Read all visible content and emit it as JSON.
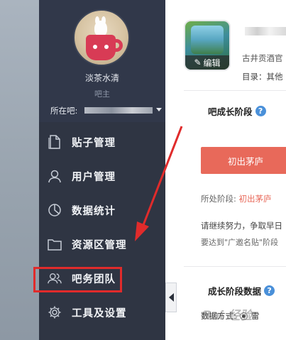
{
  "profile": {
    "name": "淡茶水清",
    "role": "吧主",
    "forum_label": "所在吧:",
    "forum_value": ""
  },
  "menu": {
    "items": [
      {
        "label": "贴子管理",
        "icon": "document-icon"
      },
      {
        "label": "用户管理",
        "icon": "user-icon"
      },
      {
        "label": "数据统计",
        "icon": "pie-chart-icon"
      },
      {
        "label": "资源区管理",
        "icon": "folder-icon"
      },
      {
        "label": "吧务团队",
        "icon": "team-icon",
        "highlighted": true
      },
      {
        "label": "工具及设置",
        "icon": "gear-icon"
      }
    ]
  },
  "forum": {
    "edit_label": "编辑",
    "desc": "古井贡酒官",
    "category": "目录：其他"
  },
  "growth": {
    "title": "吧成长阶段",
    "help": "?",
    "stage_button": "初出茅庐",
    "current_label": "所处阶段:",
    "current_value": "初出茅庐",
    "para1": "请继续努力，争取早日",
    "para2": "要达到\"广邀名贴\"阶段"
  },
  "growth_data": {
    "title": "成长阶段数据",
    "help": "?",
    "option_label": "数据方式:",
    "option_value": "雷"
  },
  "watermark": "Bai 经验",
  "colors": {
    "sidebar_bg": "#2f3543",
    "highlight": "#e02b2b",
    "stage_button": "#e8695a",
    "help_icon": "#4a90d9"
  }
}
